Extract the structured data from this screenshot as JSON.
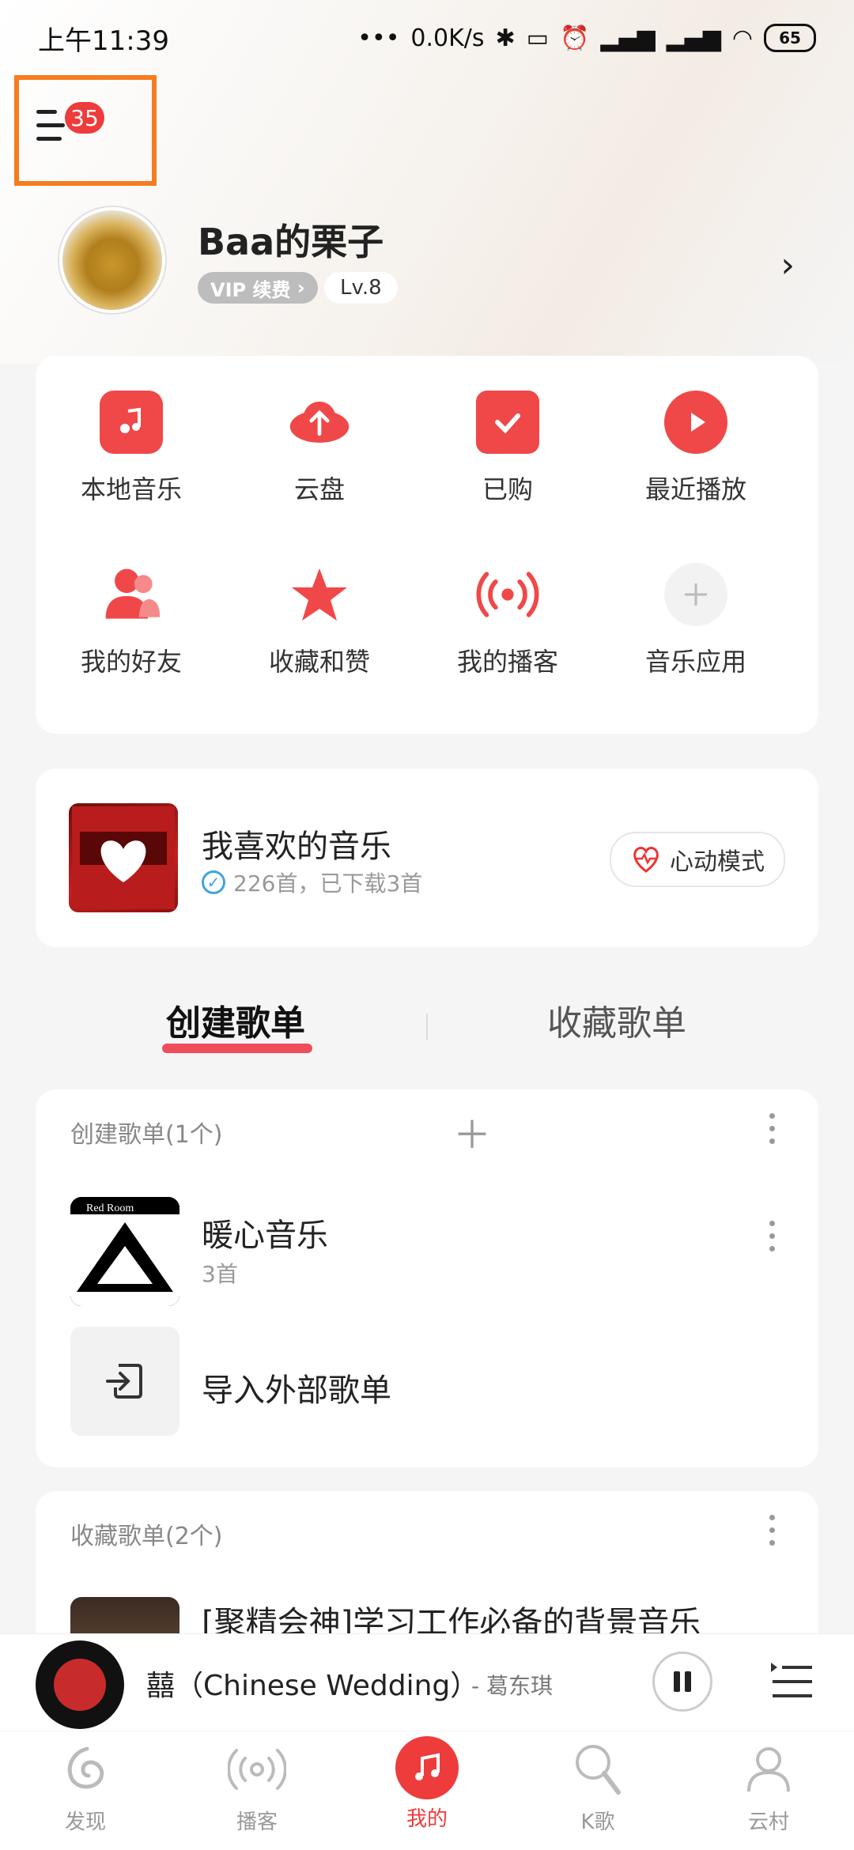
{
  "status": {
    "time": "上午11:39",
    "net_speed": "0.0K/s",
    "battery": "65"
  },
  "menu": {
    "badge": "35"
  },
  "profile": {
    "username": "Baa的栗子",
    "vip_label": "VIP 续费",
    "level": "Lv.8"
  },
  "grid": [
    {
      "label": "本地音乐",
      "icon": "local-music-icon"
    },
    {
      "label": "云盘",
      "icon": "cloud-upload-icon"
    },
    {
      "label": "已购",
      "icon": "purchased-bag-icon"
    },
    {
      "label": "最近播放",
      "icon": "recent-play-icon"
    },
    {
      "label": "我的好友",
      "icon": "friends-icon"
    },
    {
      "label": "收藏和赞",
      "icon": "star-icon"
    },
    {
      "label": "我的播客",
      "icon": "podcast-icon"
    },
    {
      "label": "音乐应用",
      "icon": "plus-icon"
    }
  ],
  "liked": {
    "title": "我喜欢的音乐",
    "subtitle": "226首，已下载3首",
    "heart_mode": "心动模式"
  },
  "tabs": {
    "created": "创建歌单",
    "favorited": "收藏歌单"
  },
  "created_section": {
    "title": "创建歌单(1个)",
    "playlist_title": "暖心音乐",
    "playlist_count": "3首",
    "cover_text": "Red Room",
    "import_label": "导入外部歌单"
  },
  "fav_section": {
    "title": "收藏歌单(2个)",
    "first_title": "[聚精会神]学习工作必备的背景音乐"
  },
  "player": {
    "song": "囍（Chinese Wedding）",
    "artist": "- 葛东琪"
  },
  "tabbar": [
    {
      "label": "发现"
    },
    {
      "label": "播客"
    },
    {
      "label": "我的"
    },
    {
      "label": "K歌"
    },
    {
      "label": "云村"
    }
  ],
  "colors": {
    "accent": "#ee3b3b",
    "highlight_box": "#f57c1f"
  }
}
